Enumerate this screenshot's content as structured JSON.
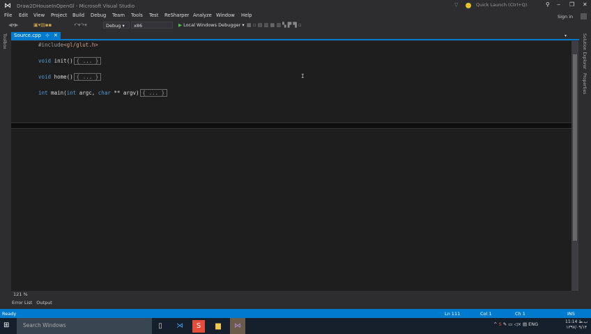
{
  "window": {
    "title": "Draw2DHouseInOpenGl - Microsoft Visual Studio",
    "quick_launch": "Quick Launch (Ctrl+Q)",
    "sign_in": "Sign in"
  },
  "menu": [
    "File",
    "Edit",
    "View",
    "Project",
    "Build",
    "Debug",
    "Team",
    "Tools",
    "Test",
    "ReSharper",
    "Analyze",
    "Window",
    "Help"
  ],
  "toolbar": {
    "configuration": "Debug",
    "platform": "x86",
    "debugger": "Local Windows Debugger"
  },
  "side": {
    "toolbox": "Toolbox",
    "solution_explorer": "Solution Explorer",
    "properties": "Properties"
  },
  "tab": {
    "name": "Source.cpp",
    "pin": "⊹",
    "close": "✕"
  },
  "code": {
    "include_directive": "#include",
    "include_file": "<gl/glut.h>",
    "void": "void",
    "init": " init()",
    "home": " home()",
    "fold": "{ ... }",
    "int": "int",
    "main": " main(",
    "int2": "int",
    " argc": " argc, ",
    "char": "char",
    "argv": " ** argv)"
  },
  "zoom": "121 %",
  "bottom_tabs": [
    "Error List",
    "Output"
  ],
  "status": {
    "state": "Ready",
    "ln": "Ln 111",
    "col": "Col 1",
    "ch": "Ch 1",
    "mode": "INS"
  },
  "taskbar": {
    "search": "Search Windows",
    "lang": "ENG",
    "time": "11:14 ب.ظ",
    "date": "۱۳۹۷/۰۹/۱۴"
  },
  "colors": {
    "accent": "#007acc",
    "editor_bg": "#1e1e1e",
    "keyword": "#569cd6"
  }
}
